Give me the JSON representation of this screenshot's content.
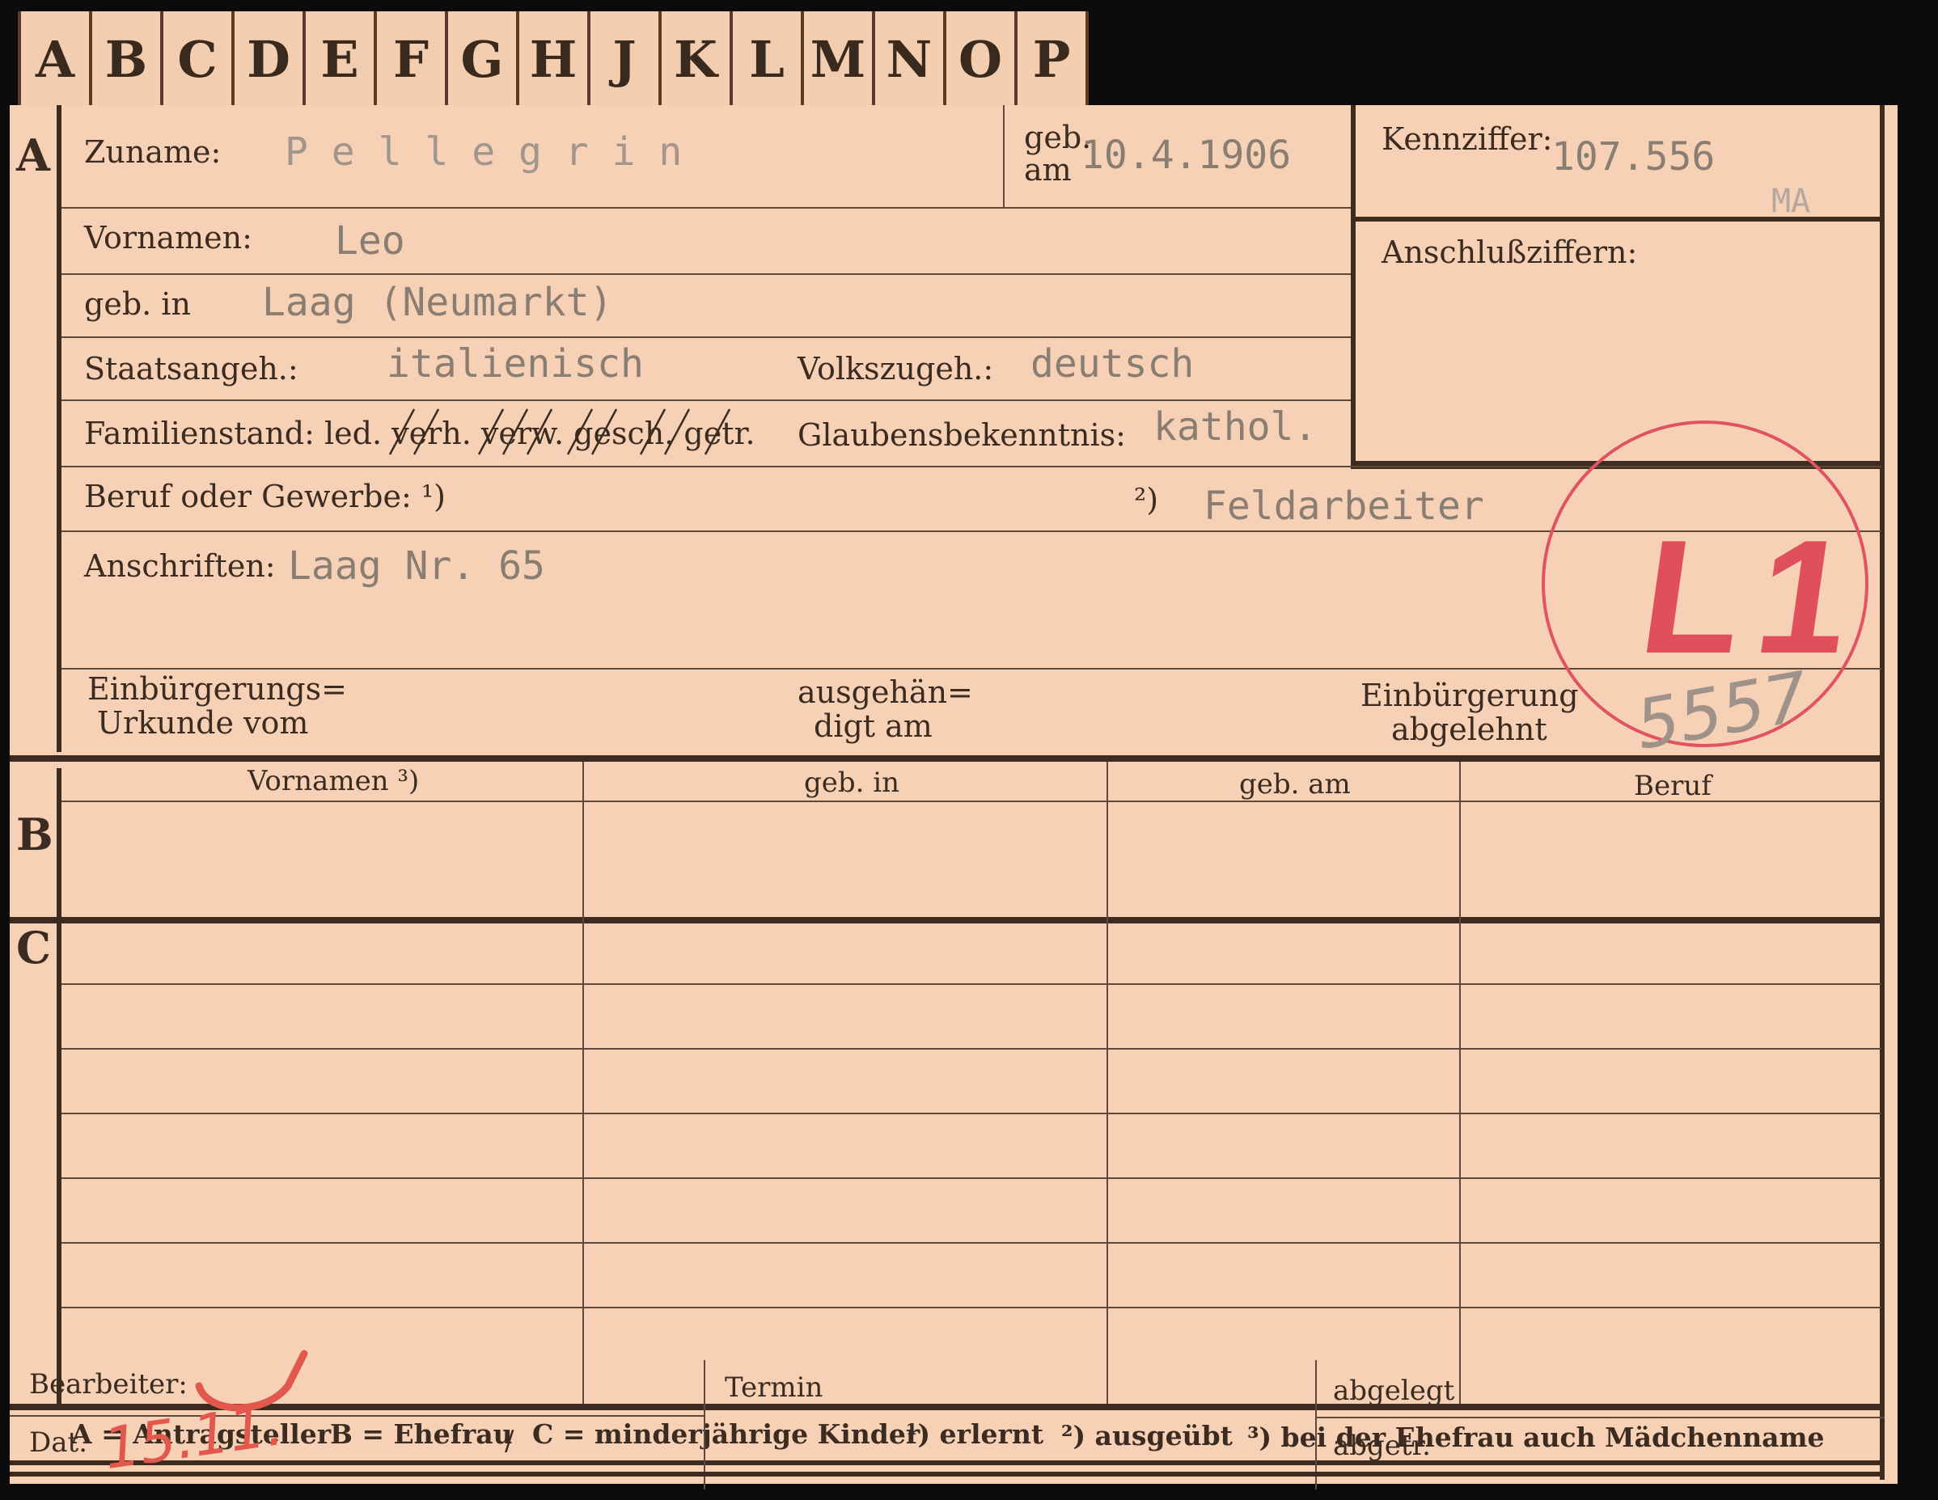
{
  "tabs": [
    "A",
    "B",
    "C",
    "D",
    "E",
    "F",
    "G",
    "H",
    "J",
    "K",
    "L",
    "M",
    "N",
    "O",
    "P"
  ],
  "sections": {
    "a": "A",
    "b": "B",
    "c": "C"
  },
  "labels": {
    "zuname": "Zuname:",
    "geb_am_top": "geb.",
    "geb_am_bottom": "am",
    "kennziffer": "Kennziffer:",
    "vornamen": "Vornamen:",
    "anschlussziffern": "Anschlußziffern:",
    "geb_in": "geb. in",
    "staatsangeh": "Staatsangeh.:",
    "volkszugeh": "Volkszugeh.:",
    "familienstand": "Familienstand: led. verh. verw. gesch. getr.",
    "glaubensbekenntnis": "Glaubensbekenntnis:",
    "beruf": "Beruf oder Gewerbe: ¹)",
    "beruf2": "²)",
    "anschriften": "Anschriften:",
    "einb_urkunde_1": "Einbürgerungs=",
    "einb_urkunde_2": "Urkunde vom",
    "ausgehaen_1": "ausgehän=",
    "ausgehaen_2": "digt am",
    "einb_abgelehnt_1": "Einbürgerung",
    "einb_abgelehnt_2": "abgelehnt"
  },
  "values": {
    "zuname": "P e l l e g r i n",
    "geb_am": "10.4.1906",
    "kennziffer": "107.556",
    "kennziffer_suffix": "MA",
    "vornamen": "Leo",
    "geb_in": "Laag (Neumarkt)",
    "staatsangeh": "italienisch",
    "volkszugeh": "deutsch",
    "glaubensbekenntnis": "kathol.",
    "beruf_ausgeuebt": "Feldarbeiter",
    "anschriften": "Laag Nr. 65"
  },
  "stamp": {
    "text": "L1",
    "number": "5557",
    "color": "#e0505a"
  },
  "table_headers": [
    "Vornamen ³)",
    "geb. in",
    "geb. am",
    "Beruf"
  ],
  "footer_legend": [
    "A = Antragsteller",
    "B = Ehefrau",
    "C = minderjährige Kinder",
    "¹) erlernt",
    "²) ausgeübt",
    "³) bei der Ehefrau auch Mädchenname"
  ],
  "bottom": {
    "bearbeiter": "Bearbeiter:",
    "dat": "Dat.",
    "dat_slash": "/",
    "dat_hand": "15.11.",
    "termin": "Termin",
    "abgelegt": "abgelegt",
    "abgetr": "abgetr."
  }
}
